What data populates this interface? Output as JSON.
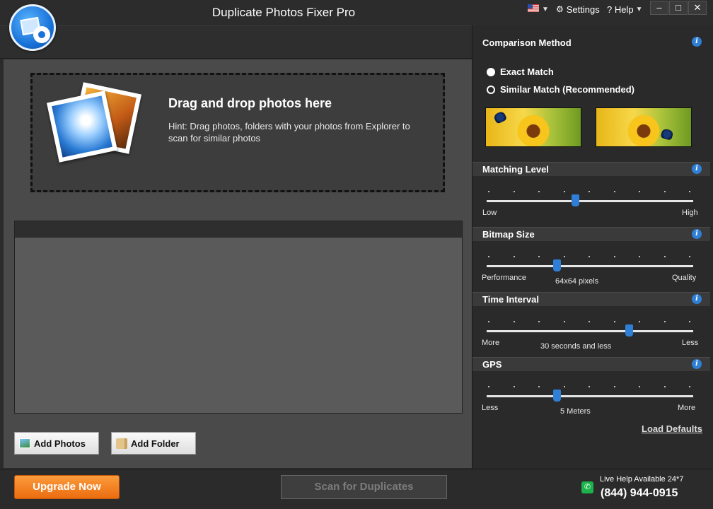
{
  "app": {
    "title": "Duplicate Photos Fixer Pro"
  },
  "topmenu": {
    "settings": "Settings",
    "help": "? Help"
  },
  "window_controls": {
    "minimize": "–",
    "maximize": "□",
    "close": "✕"
  },
  "dropzone": {
    "title": "Drag and drop photos here",
    "hint": "Hint: Drag photos, folders with your photos from Explorer to scan for similar photos"
  },
  "buttons": {
    "add_photos": "Add Photos",
    "add_folder": "Add Folder",
    "upgrade": "Upgrade Now",
    "scan": "Scan for Duplicates"
  },
  "support": {
    "live_help": "Live Help Available 24*7",
    "phone": "(844) 944-0915"
  },
  "comparison": {
    "title": "Comparison Method",
    "options": [
      {
        "label": "Exact Match",
        "selected": true
      },
      {
        "label": "Similar Match (Recommended)",
        "selected": false
      }
    ]
  },
  "matching_level": {
    "title": "Matching Level",
    "low": "Low",
    "high": "High",
    "value_fraction": 0.43
  },
  "bitmap_size": {
    "title": "Bitmap Size",
    "left": "Performance",
    "right": "Quality",
    "value_text": "64x64 pixels",
    "value_fraction": 0.34
  },
  "time_interval": {
    "title": "Time Interval",
    "left": "More",
    "right": "Less",
    "value_text": "30 seconds and less",
    "value_fraction": 0.69
  },
  "gps": {
    "title": "GPS",
    "left": "Less",
    "right": "More",
    "value_text": "5 Meters",
    "value_fraction": 0.34
  },
  "load_defaults": "Load Defaults",
  "colors": {
    "accent": "#2f7fd6",
    "upgrade": "#f0801f",
    "phone": "#1bb34a"
  },
  "icons": [
    "app-logo-icon",
    "flag-icon",
    "gear-icon",
    "info-icon",
    "photo-icon",
    "folder-icon",
    "phone-icon"
  ]
}
